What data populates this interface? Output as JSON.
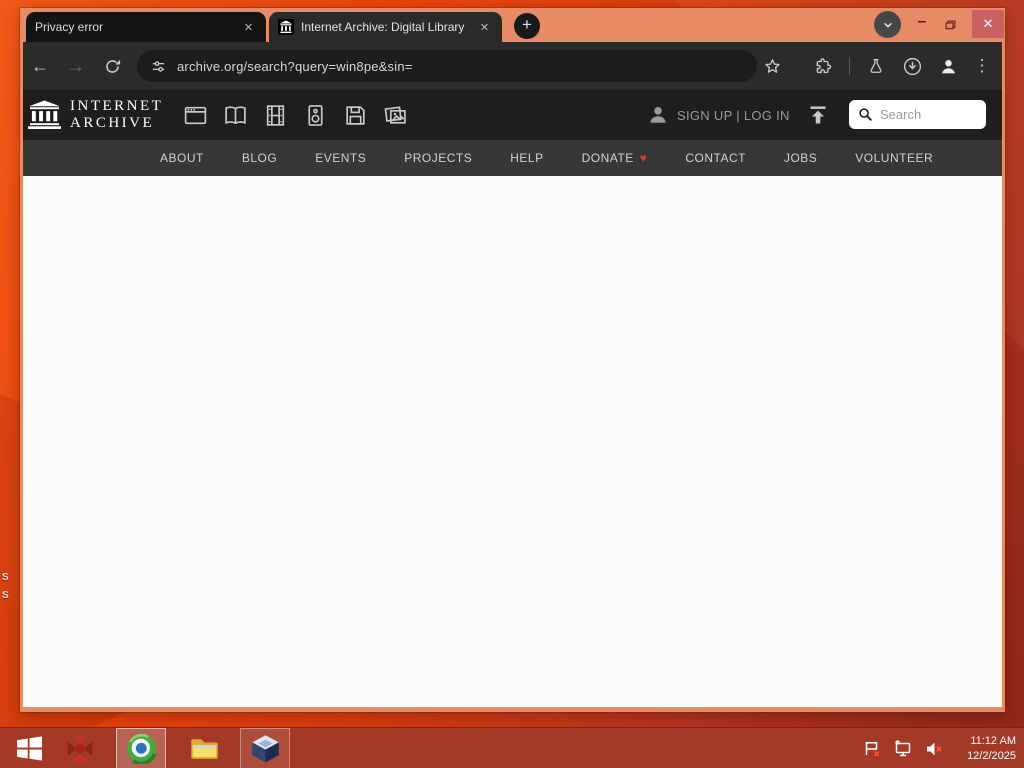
{
  "icons": {
    "plus": "+",
    "minus": "–",
    "close_x": "✕",
    "back_arrow": "←",
    "forward_arrow": "→",
    "menu_dots": "⋮",
    "heart": "♥"
  },
  "browser": {
    "tabs": [
      {
        "title": "Privacy error"
      },
      {
        "title": "Internet Archive: Digital Library"
      }
    ],
    "url": "archive.org/search?query=win8pe&sin="
  },
  "archive": {
    "logo_line1": "INTERNET",
    "logo_line2": "ARCHIVE",
    "auth_text": "SIGN UP | LOG IN",
    "search_placeholder": "Search",
    "nav_items": [
      "ABOUT",
      "BLOG",
      "EVENTS",
      "PROJECTS",
      "HELP",
      "DONATE",
      "CONTACT",
      "JOBS",
      "VOLUNTEER"
    ]
  },
  "taskbar": {
    "time": "11:12 AM",
    "date": "12/2/2025"
  },
  "desktop": {
    "fragment1": "S",
    "fragment2": "S"
  },
  "colors": {
    "desktop_orange": "#e8450e",
    "titlebar_salmon": "#e78a66",
    "toolbar_gray": "#2b2b2b",
    "tab_inactive": "#141414",
    "ia_header_bg": "#201d1d",
    "ia_nav_bg": "#373737",
    "taskbar_red": "#a33927",
    "donate_heart_red": "#e03a3a",
    "close_button_red": "#ca6161"
  }
}
